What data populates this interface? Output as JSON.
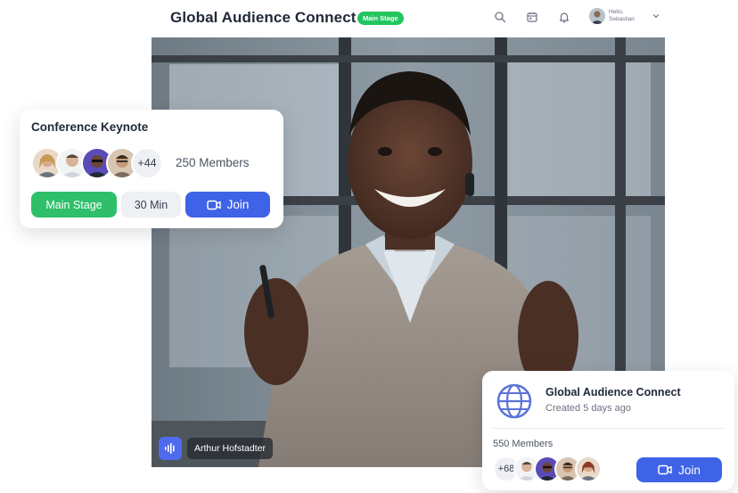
{
  "header": {
    "title": "Global Audience Connect",
    "badge": "Main Stage",
    "greeting_line1": "Hello,",
    "greeting_line2": "Sebastian",
    "icons": [
      "search-icon",
      "calendar-icon",
      "bell-icon",
      "chevron-down-icon"
    ]
  },
  "video": {
    "speaker_name": "Arthur Hofstadter",
    "speaker_icon": "audio-wave-icon"
  },
  "keynote_card": {
    "title": "Conference Keynote",
    "extra_count": "+44",
    "members": "250 Members",
    "stage_label": "Main Stage",
    "duration": "30 Min",
    "join_label": "Join"
  },
  "group_card": {
    "title": "Global Audience Connect",
    "subtitle": "Created 5 days ago",
    "members": "550 Members",
    "extra_count": "+68",
    "join_label": "Join"
  },
  "colors": {
    "green": "#2fbf6b",
    "blue": "#3f63e6",
    "mic_blue": "#4f6bed"
  }
}
